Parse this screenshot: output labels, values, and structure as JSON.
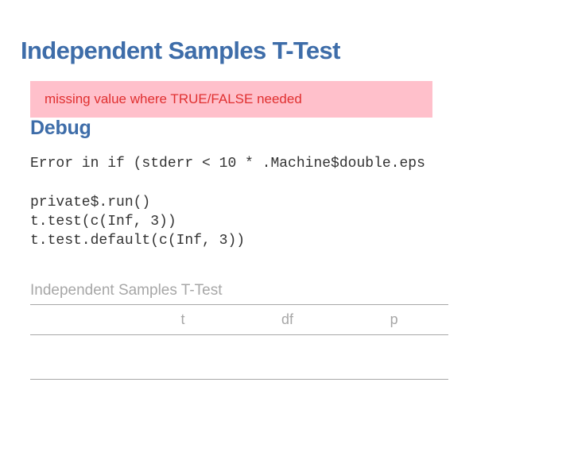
{
  "header": {
    "title": "Independent Samples T-Test"
  },
  "error": {
    "message": "missing value where TRUE/FALSE needed"
  },
  "debug": {
    "title": "Debug",
    "code": "Error in if (stderr < 10 * .Machine$double.eps\n\nprivate$.run()\nt.test(c(Inf, 3))\nt.test.default(c(Inf, 3))"
  },
  "table": {
    "caption": "Independent Samples T-Test",
    "columns": {
      "blank": "",
      "t": "t",
      "df": "df",
      "p": "p"
    }
  }
}
